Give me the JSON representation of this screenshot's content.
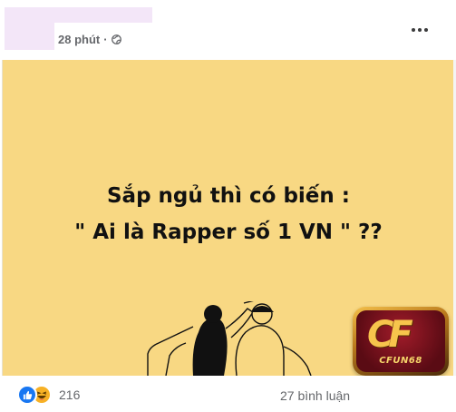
{
  "post": {
    "time_ago": "28 phút",
    "separator": "·",
    "privacy_icon": "globe-icon",
    "more_icon": "more-horizontal-icon"
  },
  "image": {
    "background": "#f8d883",
    "line1": "Sắp ngủ thì có biến :",
    "line2": "\" Ai là Rapper số 1 VN \" ??",
    "logo_mark": "CF",
    "logo_text": "CFUN68"
  },
  "footer": {
    "reaction_icons": [
      "like-icon",
      "haha-icon"
    ],
    "reaction_count": "216",
    "comments": "27 bình luận"
  }
}
